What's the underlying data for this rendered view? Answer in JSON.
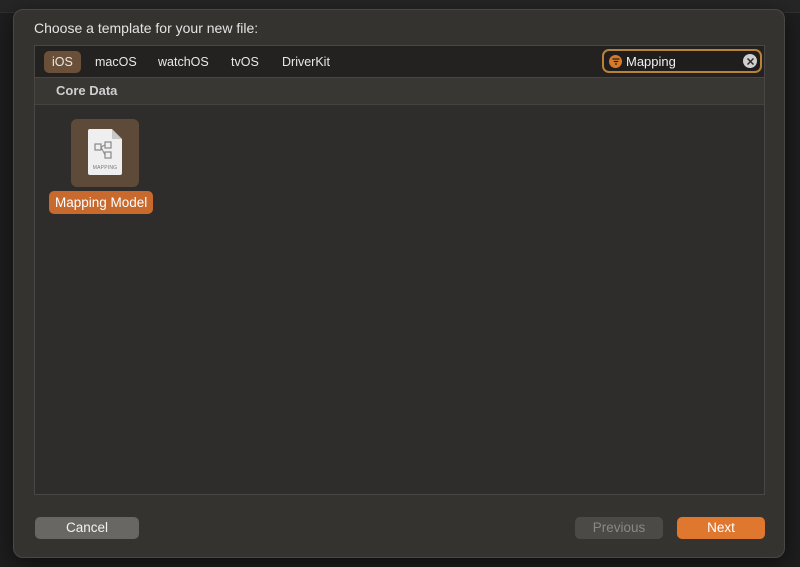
{
  "sheet": {
    "title": "Choose a template for your new file:"
  },
  "platform_tabs": [
    {
      "label": "iOS",
      "selected": true
    },
    {
      "label": "macOS",
      "selected": false
    },
    {
      "label": "watchOS",
      "selected": false
    },
    {
      "label": "tvOS",
      "selected": false
    },
    {
      "label": "DriverKit",
      "selected": false
    }
  ],
  "search": {
    "value": "Mapping",
    "icon": "filter-icon",
    "clear_icon": "clear-icon"
  },
  "sections": [
    {
      "title": "Core Data",
      "templates": [
        {
          "label": "Mapping Model",
          "icon_caption": "MAPPING",
          "selected": true
        }
      ]
    }
  ],
  "buttons": {
    "cancel": "Cancel",
    "previous": "Previous",
    "next": "Next",
    "previous_enabled": false
  },
  "colors": {
    "accent": "#e0772f",
    "selection": "#c8692d",
    "tab_selected": "#6a5039"
  }
}
